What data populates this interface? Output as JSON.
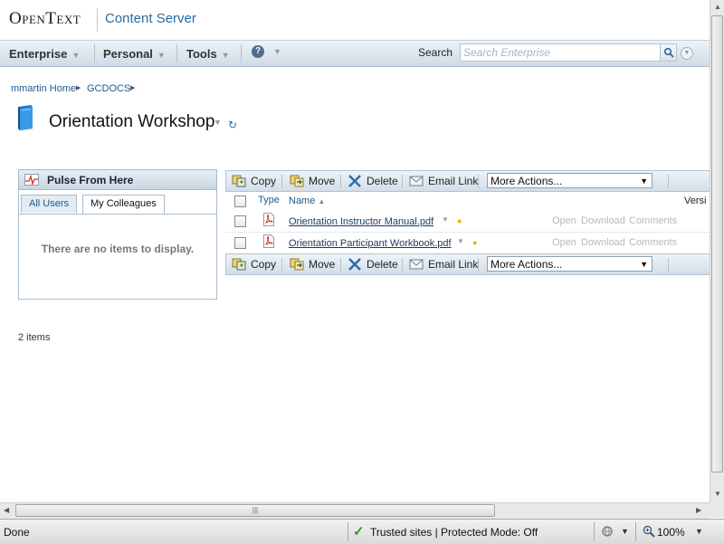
{
  "header": {
    "logo_text": "OpenText",
    "product_name": "Content Server"
  },
  "menubar": {
    "items": [
      {
        "label": "Enterprise"
      },
      {
        "label": "Personal"
      },
      {
        "label": "Tools"
      }
    ],
    "help_label": "?",
    "search_label": "Search",
    "search_placeholder": "Search Enterprise"
  },
  "breadcrumb": [
    {
      "label": "mmartin Home"
    },
    {
      "label": "GCDOCS"
    }
  ],
  "page": {
    "title": "Orientation Workshop",
    "items_count": "2 items"
  },
  "pulse": {
    "title": "Pulse From Here",
    "tabs": [
      {
        "label": "All Users"
      },
      {
        "label": "My Colleagues",
        "selected": true
      }
    ],
    "empty_message": "There are no items to display."
  },
  "toolbar": {
    "copy": "Copy",
    "move": "Move",
    "delete": "Delete",
    "email_link": "Email Link",
    "more_actions": "More Actions..."
  },
  "columns": {
    "type": "Type",
    "name": "Name",
    "version": "Versi"
  },
  "files": [
    {
      "name": "Orientation Instructor Manual.pdf",
      "actions": [
        "Open",
        "Download",
        "Comments"
      ]
    },
    {
      "name": "Orientation Participant Workbook.pdf",
      "actions": [
        "Open",
        "Download",
        "Comments"
      ]
    }
  ],
  "statusbar": {
    "status": "Done",
    "zone": "Trusted sites | Protected Mode: Off",
    "zoom": "100%"
  },
  "colors": {
    "link": "#1c5a90",
    "toolbar_bg": "#d2dee8",
    "brand_blue": "#2a6aa0",
    "disabled_action": "#b8b8b8"
  }
}
